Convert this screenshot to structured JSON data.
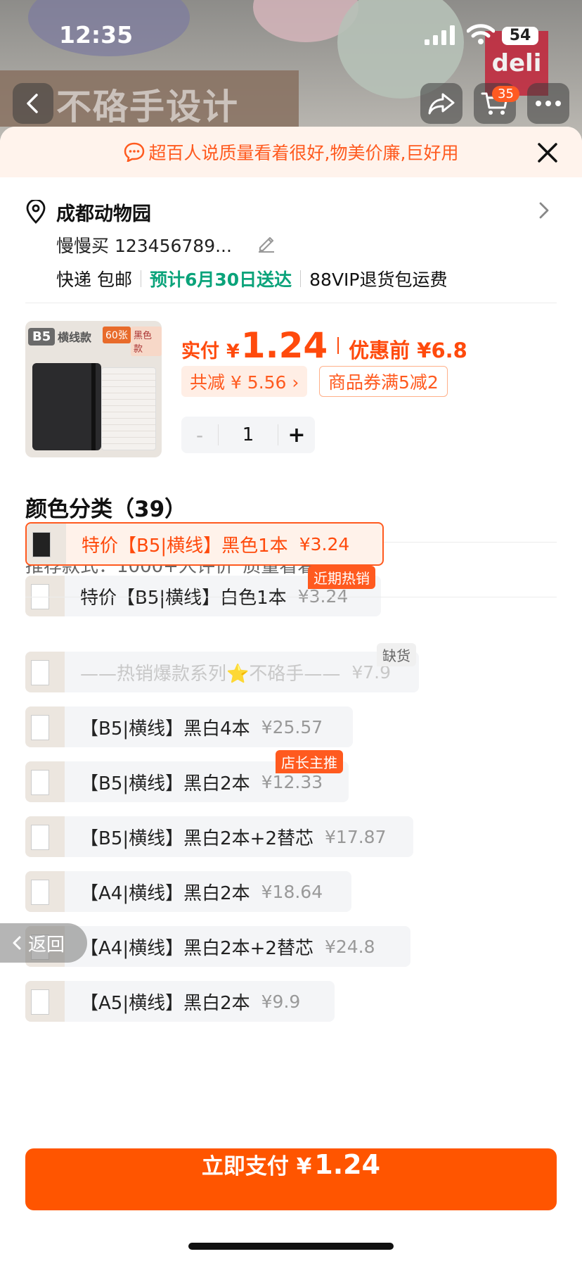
{
  "status_bar": {
    "time": "12:35",
    "battery": "54"
  },
  "header": {
    "cart_count": "35",
    "background_ghost_text": "不硌手设计",
    "brand_logo": "deli"
  },
  "notice": {
    "text": "超百人说质量看着很好,物美价廉,巨好用"
  },
  "address": {
    "name": "成都动物园",
    "person": "慢慢买  123456789...",
    "shipping": "快递 包邮",
    "eta": "预计6月30日送达",
    "vip": "88VIP退货包运费"
  },
  "product": {
    "thumb_tag": "B5",
    "thumb_label": "横线款",
    "thumb_badge1": "60张",
    "thumb_badge2": "黑色款",
    "pay_label": "实付",
    "pay_yen": "¥",
    "pay_price": "1.24",
    "orig_label": "优惠前 ¥6.8",
    "reduce_chip": "共减 ¥ 5.56 ›",
    "coupon_chip": "商品券满5减2",
    "quantity": "1",
    "minus": "-",
    "plus": "+"
  },
  "color_section": {
    "title": "颜色分类（39）",
    "recommend": "推荐款式：1000+人评价“质量看着很好”"
  },
  "skus": [
    {
      "name": "特价【B5|横线】黑色1本",
      "price": "¥3.24",
      "state": "selected"
    },
    {
      "name": "特价【B5|横线】白色1本",
      "price": "¥3.24",
      "tag": "近期热销"
    },
    {
      "name": "——热销爆款系列⭐不硌手——",
      "price": "¥7.9",
      "tag": "缺货",
      "state": "disabled"
    },
    {
      "name": "【B5|横线】黑白4本",
      "price": "¥25.57"
    },
    {
      "name": "【B5|横线】黑白2本",
      "price": "¥12.33",
      "tag": "店长主推"
    },
    {
      "name": "【B5|横线】黑白2本+2替芯",
      "price": "¥17.87"
    },
    {
      "name": "【A4|横线】黑白2本",
      "price": "¥18.64"
    },
    {
      "name": "【A4|横线】黑白2本+2替芯",
      "price": "¥24.8"
    },
    {
      "name": "【A5|横线】黑白2本",
      "price": "¥9.9"
    }
  ],
  "float_back": {
    "label": "返回"
  },
  "pay_button": {
    "label": "立即支付 ¥",
    "amount": "1.24"
  },
  "colors": {
    "accent": "#ff5500",
    "eta_green": "#0aa37a"
  },
  "icons": [
    "back-icon",
    "share-icon",
    "cart-icon",
    "more-icon",
    "chat-icon",
    "close-icon",
    "location-pin-icon",
    "chevron-right-icon",
    "edit-icon",
    "signal-icon",
    "wifi-icon"
  ]
}
